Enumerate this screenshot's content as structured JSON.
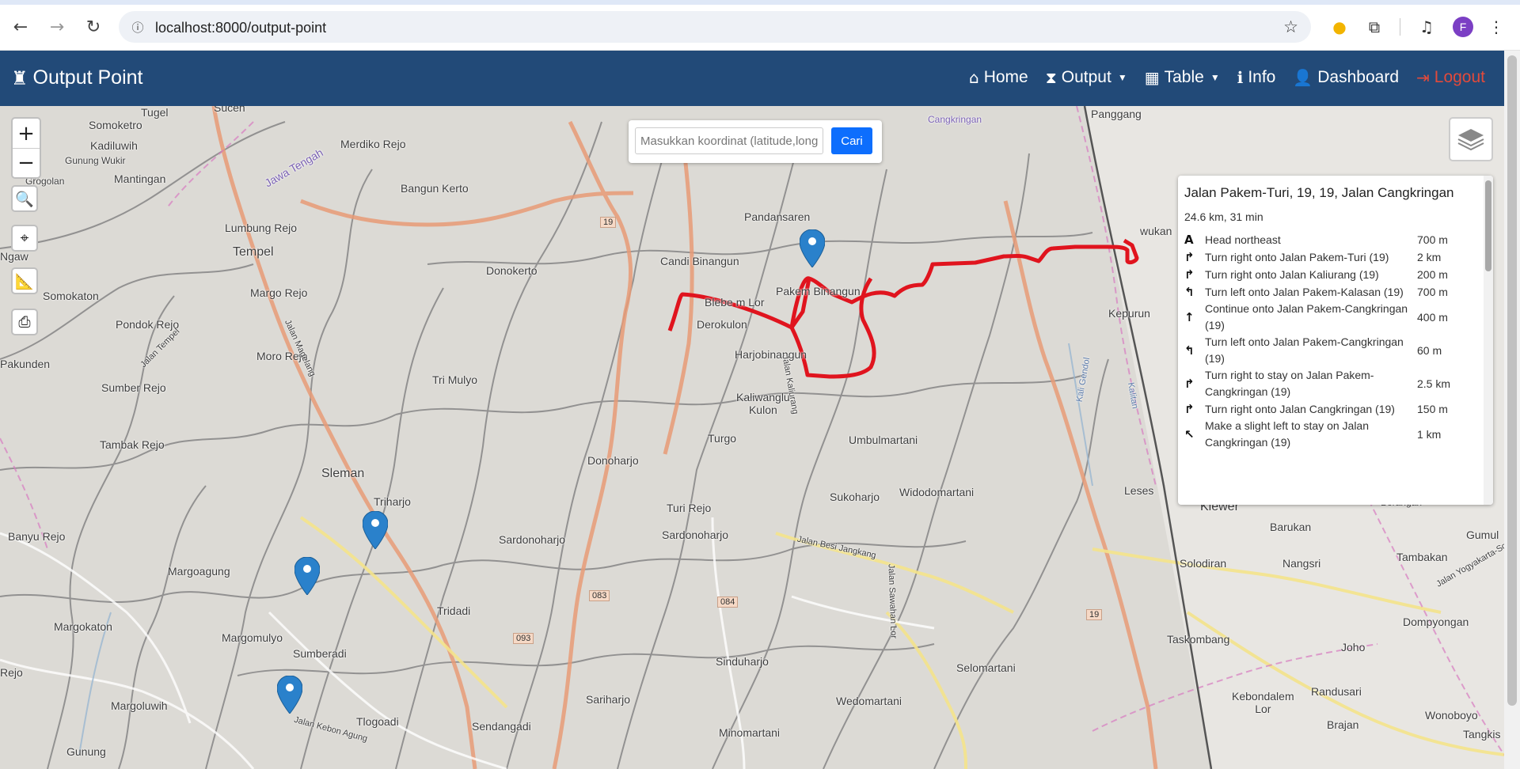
{
  "browser": {
    "url": "localhost:8000/output-point",
    "profile_initial": "F"
  },
  "navbar": {
    "brand": "Output Point",
    "links": [
      {
        "label": "Home",
        "icon": "home-icon"
      },
      {
        "label": "Output",
        "icon": "hourglass-icon",
        "dropdown": true
      },
      {
        "label": "Table",
        "icon": "table-icon",
        "dropdown": true
      },
      {
        "label": "Info",
        "icon": "info-icon"
      },
      {
        "label": "Dashboard",
        "icon": "user-icon"
      },
      {
        "label": "Logout",
        "icon": "logout-icon"
      }
    ],
    "logout_color": "#e24a3b",
    "bg_color": "#224a78"
  },
  "search": {
    "placeholder": "Masukkan koordinat (latitude,longitude)",
    "button": "Cari"
  },
  "routing": {
    "title": "Jalan Pakem-Turi, 19, 19, Jalan Cangkringan",
    "summary": "24.6 km, 31 min",
    "steps": [
      {
        "icon": "depart-icon",
        "text": "Head northeast",
        "distance": "700 m"
      },
      {
        "icon": "turn-right-icon",
        "text": "Turn right onto Jalan Pakem-Turi (19)",
        "distance": "2 km"
      },
      {
        "icon": "turn-right-icon",
        "text": "Turn right onto Jalan Kaliurang (19)",
        "distance": "200 m"
      },
      {
        "icon": "turn-left-icon",
        "text": "Turn left onto Jalan Pakem-Kalasan (19)",
        "distance": "700 m"
      },
      {
        "icon": "straight-icon",
        "text": "Continue onto Jalan Pakem-Cangkringan (19)",
        "distance": "400 m"
      },
      {
        "icon": "turn-left-icon",
        "text": "Turn left onto Jalan Pakem-Cangkringan (19)",
        "distance": "60 m"
      },
      {
        "icon": "turn-right-icon",
        "text": "Turn right to stay on Jalan Pakem-Cangkringan (19)",
        "distance": "2.5 km"
      },
      {
        "icon": "turn-right-icon",
        "text": "Turn right onto Jalan Cangkringan (19)",
        "distance": "150 m"
      },
      {
        "icon": "slight-left-icon",
        "text": "Make a slight left to stay on Jalan Cangkringan (19)",
        "distance": "1 km"
      }
    ]
  },
  "map_labels": {
    "sucen": "Sucen",
    "tugel": "Tugel",
    "somoketro": "Somoketro",
    "kadiluwih": "Kadiluwih",
    "gunung_wukir": "Gunung Wukir",
    "grogolan": "Grogolan",
    "mantingan": "Mantingan",
    "jawa_tengah": "Jawa Tengah",
    "merdiko_rejo": "Merdiko Rejo",
    "bangun_kerto": "Bangun Kerto",
    "lumbung_rejo": "Lumbung Rejo",
    "tempel": "Tempel",
    "ngawen": "Ngaw",
    "somokaton": "Somokaton",
    "margo_rejo": "Margo Rejo",
    "pondok_rejo": "Pondok Rejo",
    "donokerto": "Donokerto",
    "moro_rejo": "Moro Rejo",
    "pakunden": "Pakunden",
    "sumber_rejo": "Sumber Rejo",
    "tri_mulyo": "Tri Mulyo",
    "tambak_rejo": "Tambak Rejo",
    "sleman": "Sleman",
    "triharjo": "Triharjo",
    "banyu_rejo": "Banyu Rejo",
    "margoagung": "Margoagung",
    "margokaton": "Margokaton",
    "margomulyo": "Margomulyo",
    "sumberadi": "Sumberadi",
    "tridadi": "Tridadi",
    "margoluwih": "Margoluwih",
    "tlogoadi": "Tlogoadi",
    "rejo": "Rejo",
    "sendangadi": "Sendangadi",
    "gunung_sempu": "Gunung",
    "candi_binangun": "Candi Binangun",
    "pandansaren": "Pandansaren",
    "pakem_binangun": "Pakem Binangun",
    "bleberan_lor": "Blebe  m Lor",
    "derokulon": "Derokulon",
    "harjobinangun": "Harjobinangun",
    "kaliwanglu_kulon": "Kaliwanglu\nKulon",
    "turgo": "Turgo",
    "donoharjo": "Donoharjo",
    "turi_rejo": "Turi Rejo",
    "sardonoharjo": "Sardonoharjo",
    "sardonoharjo2": "Sardonoharjo",
    "sinduharjo": "Sinduharjo",
    "sariharjo": "Sariharjo",
    "minomartani": "Minomartani",
    "umbulmartani": "Umbulmartani",
    "widodomartani": "Widodomartani",
    "sukoharjo": "Sukoharjo",
    "selomartani": "Selomartani",
    "wedomartani": "Wedomartani",
    "panggang": "Panggang",
    "cangkringan": "Cangkringan",
    "kepuhan": "Kepurun",
    "wukan": "wukan",
    "leses": "Leses",
    "klewer": "Klewer",
    "barukan": "Barukan",
    "borangan": "Borangan",
    "gumul": "Gumul",
    "solodiran": "Solodiran",
    "nangsri": "Nangsri",
    "tambakan": "Tambakan",
    "dompyongan": "Dompyongan",
    "taskombang": "Taskombang",
    "joho": "Joho",
    "kebondalem_lor": "Kebondalem\nLor",
    "randusari": "Randusari",
    "wonoboyo": "Wonoboyo",
    "brajan": "Brajan",
    "tangkis": "Tangkis",
    "jalan_besi_jangkang": "Jalan Besi Jangkang",
    "jalan_kaliurang": "Jalan Kaliurang",
    "jalan_kebon_agung": "Jalan Kebon Agung",
    "jalan_tempel": "Jalan Tempel",
    "jalan_magelang": "Jalan Magelang",
    "jalan_sawahan_lor": "Jalan Sawahan Lor",
    "jalan_yogyakarta_solo": "Jalan Yogyakarta-Solo",
    "kali_gendol": "Kali Gendol",
    "kalitan": "Kalitan"
  },
  "road_badges": [
    "19",
    "19",
    "083",
    "084",
    "093",
    "19"
  ],
  "route_color": "#e0141e",
  "marker_color": "#2a81cb"
}
